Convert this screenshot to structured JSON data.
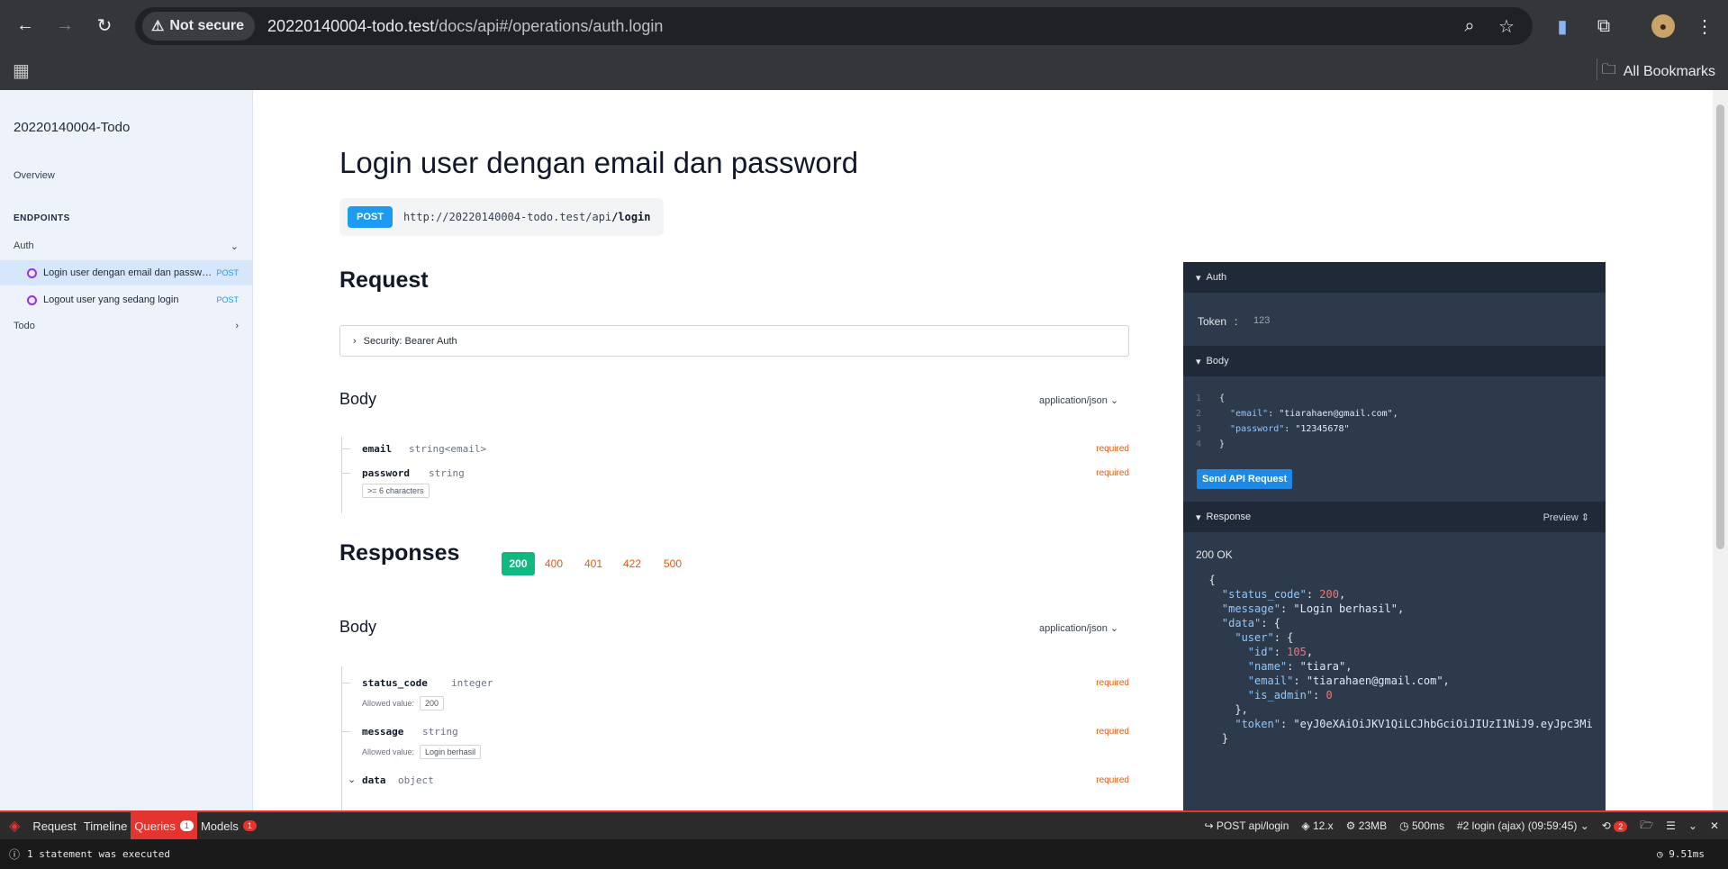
{
  "browser": {
    "security_label": "Not secure",
    "url_host": "20220140004-todo.test",
    "url_path": "/docs/api#/operations/auth.login",
    "bookmarks_label": "All Bookmarks"
  },
  "sidebar": {
    "title": "20220140004-Todo",
    "overview": "Overview",
    "endpoints_heading": "ENDPOINTS",
    "group_auth": "Auth",
    "group_todo": "Todo",
    "ops": [
      {
        "label": "Login user dengan email dan password",
        "method": "POST"
      },
      {
        "label": "Logout user yang sedang login",
        "method": "POST"
      }
    ]
  },
  "main": {
    "title": "Login user dengan email dan password",
    "method": "POST",
    "url_base": "http://20220140004-todo.test/api",
    "url_last": "/login",
    "request_heading": "Request",
    "security_label": "Security: Bearer Auth",
    "body_heading": "Body",
    "content_type": "application/json",
    "fields": [
      {
        "name": "email",
        "type": "string<email>",
        "req": "required"
      },
      {
        "name": "password",
        "type": "string",
        "req": "required",
        "constraint": ">= 6 characters"
      }
    ],
    "responses_heading": "Responses",
    "response_codes": [
      "200",
      "400",
      "401",
      "422",
      "500"
    ],
    "resp_body_heading": "Body",
    "resp_content_type": "application/json",
    "resp_fields": [
      {
        "name": "status_code",
        "type": "integer",
        "req": "required",
        "allowed_label": "Allowed value:",
        "allowed": "200"
      },
      {
        "name": "message",
        "type": "string",
        "req": "required",
        "allowed_label": "Allowed value:",
        "allowed": "Login berhasil"
      },
      {
        "name": "data",
        "type": "object",
        "req": "required"
      }
    ]
  },
  "panel": {
    "auth_heading": "Auth",
    "token_label": "Token",
    "token_sep": ":",
    "token_value": "123",
    "body_heading": "Body",
    "body_lines": [
      {
        "n": "1",
        "text": "{"
      },
      {
        "n": "2",
        "key": "\"email\"",
        "val": "\"tiarahaen@gmail.com\","
      },
      {
        "n": "3",
        "key": "\"password\"",
        "val": "\"12345678\""
      },
      {
        "n": "4",
        "text": "}"
      }
    ],
    "send_label": "Send API Request",
    "response_heading": "Response",
    "preview_label": "Preview",
    "status": "200 OK",
    "response_lines": [
      {
        "indent": "  ",
        "text": "{"
      },
      {
        "indent": "    ",
        "key": "\"status_code\"",
        "sep": ": ",
        "num": "200",
        "tail": ","
      },
      {
        "indent": "    ",
        "key": "\"message\"",
        "sep": ": ",
        "str": "\"Login berhasil\"",
        "tail": ","
      },
      {
        "indent": "    ",
        "key": "\"data\"",
        "sep": ": ",
        "tail": "{"
      },
      {
        "indent": "      ",
        "key": "\"user\"",
        "sep": ": ",
        "tail": "{"
      },
      {
        "indent": "        ",
        "key": "\"id\"",
        "sep": ": ",
        "num": "105",
        "tail": ","
      },
      {
        "indent": "        ",
        "key": "\"name\"",
        "sep": ": ",
        "str": "\"tiara\"",
        "tail": ","
      },
      {
        "indent": "        ",
        "key": "\"email\"",
        "sep": ": ",
        "str": "\"tiarahaen@gmail.com\"",
        "tail": ","
      },
      {
        "indent": "        ",
        "key": "\"is_admin\"",
        "sep": ": ",
        "num": "0",
        "tail": ""
      },
      {
        "indent": "      ",
        "text": "},"
      },
      {
        "indent": "      ",
        "key": "\"token\"",
        "sep": ": ",
        "str": "\"eyJ0eXAiOiJKV1QiLCJhbGciOiJIUzI1NiJ9.eyJpc3Mi",
        "tail": ""
      },
      {
        "indent": "    ",
        "text": "}"
      }
    ]
  },
  "debugbar": {
    "tabs": [
      {
        "label": "Request"
      },
      {
        "label": "Timeline"
      },
      {
        "label": "Queries",
        "badge": "1",
        "active": true
      },
      {
        "label": "Models",
        "badge": "1"
      }
    ],
    "route": "POST api/login",
    "version": "12.x",
    "memory": "23MB",
    "time": "500ms",
    "request_label": "#2 login (ajax) (09:59:45)",
    "history_badge": "2",
    "status_text": "1 statement was executed",
    "duration": "9.51ms"
  }
}
